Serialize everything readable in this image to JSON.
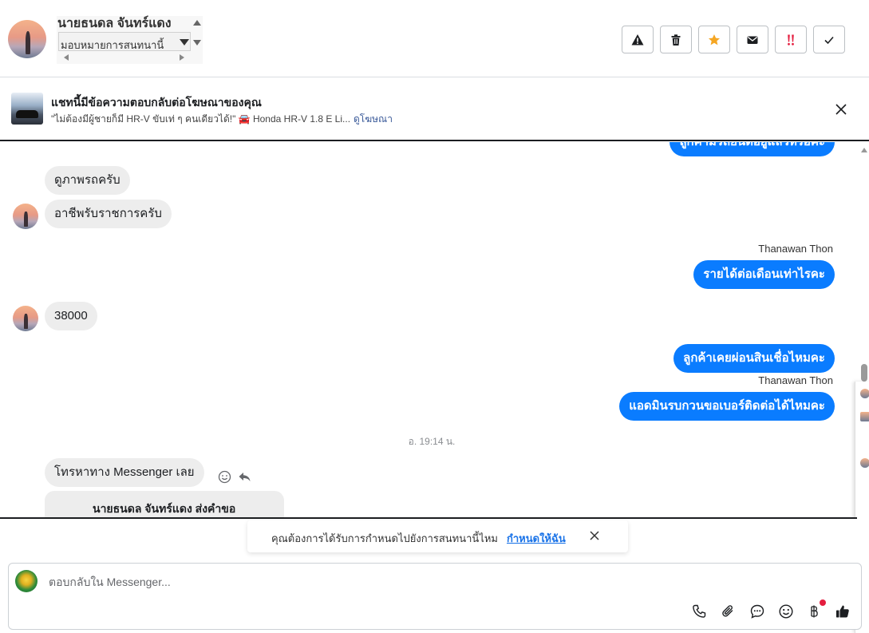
{
  "header": {
    "contact_name": "นายธนดล จันทร์แดง",
    "assign_selected": "มอบหมายการสนทนานี้",
    "actions": [
      {
        "icon": "warning-icon",
        "color": "#1c1e21"
      },
      {
        "icon": "trash-icon",
        "color": "#1c1e21"
      },
      {
        "icon": "star-icon",
        "color": "#f5a623"
      },
      {
        "icon": "mail-icon",
        "color": "#1c1e21"
      },
      {
        "icon": "double-exclamation-icon",
        "color": "#e41e3f"
      },
      {
        "icon": "checkmark-icon",
        "color": "#1c1e21"
      }
    ]
  },
  "ad_banner": {
    "title": "แชทนี้มีข้อความตอบกลับต่อโฆษณาของคุณ",
    "snippet": "\"ไม่ต้องมีผู้ชายก็มี HR-V ขับเท่ ๆ คนเดียวได้!\" 🚘 Honda HR-V 1.8 E Li...",
    "link": "ดูโฆษณา"
  },
  "messages": {
    "partial_out": "ลูกค้ามีรถยนต์อยู่แล้วหรือคะ",
    "in_1": "ดูภาพรถครับ",
    "in_2": "อาชีพรับราชการครับ",
    "sender_1": "Thanawan Thon",
    "out_1": "รายได้ต่อเดือนเท่าไรคะ",
    "in_3": "38000",
    "out_2": "ลูกค้าเคยผ่อนสินเชื่อไหมคะ",
    "sender_2": "Thanawan Thon",
    "out_3": "แอดมินรบกวนขอเบอร์ติดต่อได้ไหมคะ",
    "timestamp": "อ. 19:14 น.",
    "in_4": "โทรหาทาง Messenger เลย",
    "card_title": "นายธนดล จันทร์แดง ส่งคำขอ"
  },
  "assign_toast": {
    "text": "คุณต้องการได้รับการกำหนดไปยังการสนทนานี้ไหม",
    "link": "กำหนดให้ฉัน"
  },
  "composer": {
    "placeholder": "ตอบกลับใน Messenger...",
    "tools": [
      "phone-icon",
      "paperclip-icon",
      "chat-bubble-icon",
      "smiley-icon",
      "baht-icon",
      "thumbs-up-icon"
    ]
  },
  "colors": {
    "outgoing_bubble": "#0a7cff",
    "incoming_bubble": "#ededed",
    "link": "#385898",
    "accent_star": "#f5a623",
    "urgent_red": "#e41e3f"
  }
}
